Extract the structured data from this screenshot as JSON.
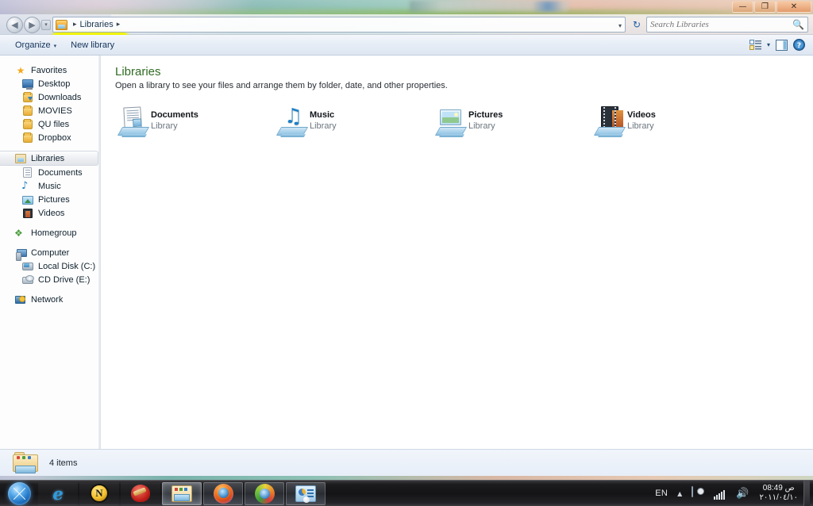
{
  "window": {
    "controls": {
      "minimize": "—",
      "maximize": "❐",
      "close": "✕"
    }
  },
  "navbar": {
    "back_icon": "◀",
    "forward_icon": "▶",
    "recent_icon": "▾",
    "breadcrumb": {
      "icon": "libraries-icon",
      "separator": "▸",
      "items": [
        "Libraries"
      ],
      "trailing_separator": "▸"
    },
    "address_dropdown_icon": "▾",
    "refresh_icon": "↻",
    "search": {
      "placeholder": "Search Libraries",
      "value": "",
      "icon": "🔍"
    }
  },
  "toolbar": {
    "organize_label": "Organize",
    "organize_caret": "▾",
    "new_library_label": "New library",
    "view_caret": "▾"
  },
  "sidebar": {
    "groups": [
      {
        "header": {
          "label": "Favorites",
          "icon": "star-icon"
        },
        "items": [
          {
            "label": "Desktop",
            "icon": "desktop-icon"
          },
          {
            "label": "Downloads",
            "icon": "downloads-folder-icon"
          },
          {
            "label": "MOVIES",
            "icon": "folder-icon"
          },
          {
            "label": "QU files",
            "icon": "folder-icon"
          },
          {
            "label": "Dropbox",
            "icon": "folder-icon"
          }
        ]
      },
      {
        "header": {
          "label": "Libraries",
          "icon": "libraries-icon",
          "selected": true
        },
        "items": [
          {
            "label": "Documents",
            "icon": "document-icon"
          },
          {
            "label": "Music",
            "icon": "music-note-icon"
          },
          {
            "label": "Pictures",
            "icon": "picture-icon"
          },
          {
            "label": "Videos",
            "icon": "video-icon"
          }
        ]
      },
      {
        "header": {
          "label": "Homegroup",
          "icon": "homegroup-icon"
        },
        "items": []
      },
      {
        "header": {
          "label": "Computer",
          "icon": "computer-icon"
        },
        "items": [
          {
            "label": "Local Disk (C:)",
            "icon": "hard-disk-icon"
          },
          {
            "label": "CD Drive (E:)",
            "icon": "cd-drive-icon"
          }
        ]
      },
      {
        "header": {
          "label": "Network",
          "icon": "network-icon"
        },
        "items": []
      }
    ]
  },
  "content": {
    "title": "Libraries",
    "subtitle": "Open a library to see your files and arrange them by folder, date, and other properties.",
    "libraries": [
      {
        "name": "Documents",
        "type": "Library",
        "icon": "documents-library-icon"
      },
      {
        "name": "Music",
        "type": "Library",
        "icon": "music-library-icon"
      },
      {
        "name": "Pictures",
        "type": "Library",
        "icon": "pictures-library-icon"
      },
      {
        "name": "Videos",
        "type": "Library",
        "icon": "videos-library-icon"
      }
    ]
  },
  "status": {
    "icon": "libraries-folder-icon",
    "text": "4 items"
  },
  "taskbar": {
    "start_label": "Start",
    "buttons": [
      {
        "name": "internet-explorer",
        "glyph": "e",
        "state": "pinned"
      },
      {
        "name": "norton-security",
        "glyph": "N",
        "state": "pinned"
      },
      {
        "name": "ccleaner",
        "glyph": "",
        "state": "pinned"
      },
      {
        "name": "windows-explorer",
        "glyph": "",
        "state": "active"
      },
      {
        "name": "mozilla-firefox",
        "glyph": "",
        "state": "open"
      },
      {
        "name": "internet-download-manager",
        "glyph": "",
        "state": "open"
      },
      {
        "name": "control-panel-app",
        "glyph": "",
        "state": "open"
      }
    ],
    "tray": {
      "language": "EN",
      "chevron": "▲",
      "action_center_icon": "action-center-icon",
      "network_icon": "network-signal-icon",
      "volume_icon": "🔊",
      "clock_time": "08:49 ص",
      "clock_date": "٢٠١١/٠٤/١٠"
    }
  },
  "colors": {
    "accent_green": "#2f6b22",
    "highlight_yellow": "#f2f500",
    "link_blue": "#16324c",
    "taskbar_dark": "#161618"
  }
}
